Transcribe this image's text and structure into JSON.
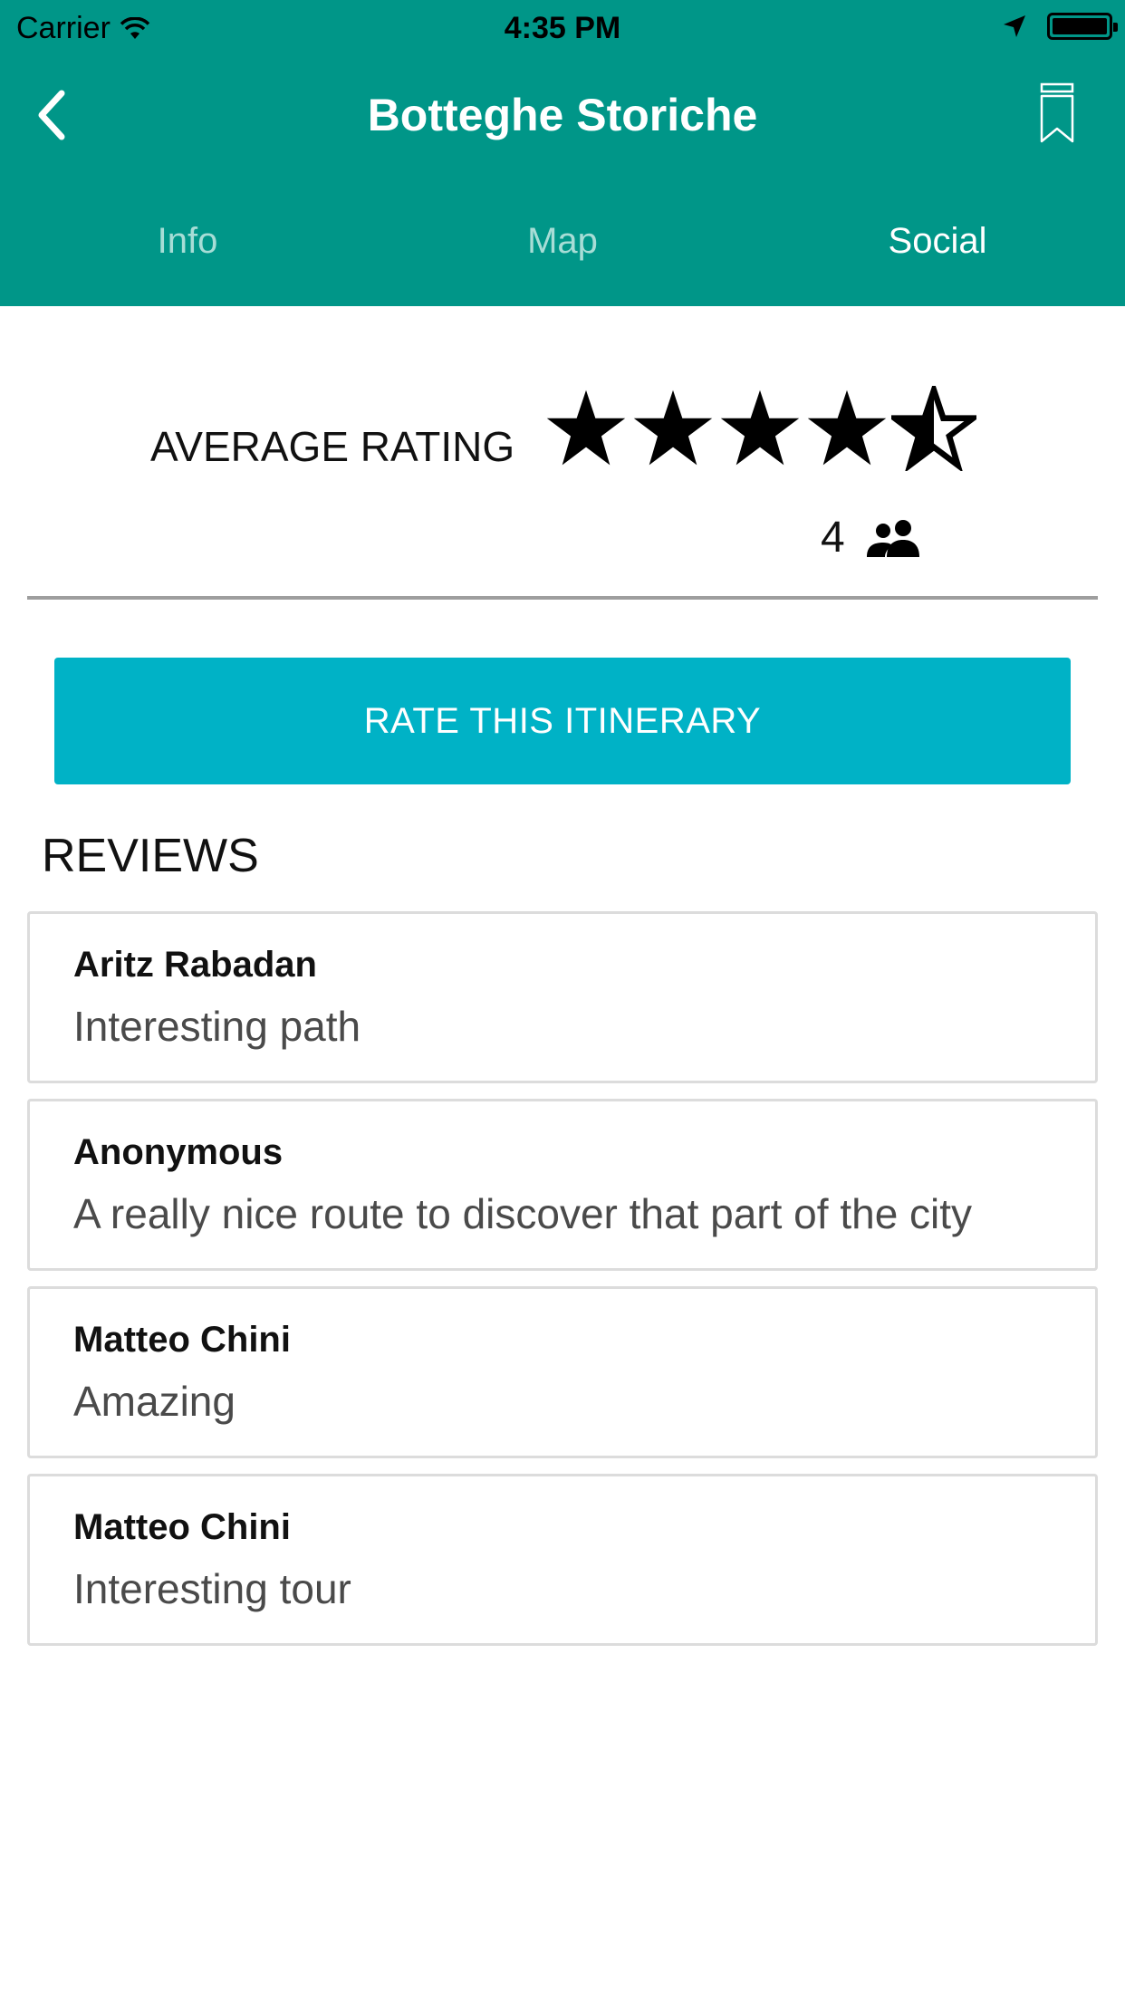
{
  "status_bar": {
    "carrier": "Carrier",
    "time": "4:35 PM",
    "battery_level": 1.0
  },
  "header": {
    "title": "Botteghe Storiche",
    "back_icon": "chevron-left-icon",
    "bookmark_icon": "bookmark-icon",
    "background_color": "#009688"
  },
  "tabs": [
    {
      "label": "Info",
      "active": false
    },
    {
      "label": "Map",
      "active": false
    },
    {
      "label": "Social",
      "active": true
    }
  ],
  "rating": {
    "label": "AVERAGE RATING",
    "stars_value": 4.5,
    "stars_max": 5,
    "count": "4",
    "count_icon": "people-icon"
  },
  "rate_button": {
    "label": "RATE THIS ITINERARY",
    "color": "#00b2c6"
  },
  "reviews": {
    "title": "REVIEWS",
    "items": [
      {
        "author": "Aritz Rabadan",
        "text": "Interesting path"
      },
      {
        "author": "Anonymous",
        "text": "A really nice route to discover that part of the city"
      },
      {
        "author": "Matteo Chini",
        "text": "Amazing"
      },
      {
        "author": "Matteo Chini",
        "text": "Interesting tour"
      }
    ]
  }
}
